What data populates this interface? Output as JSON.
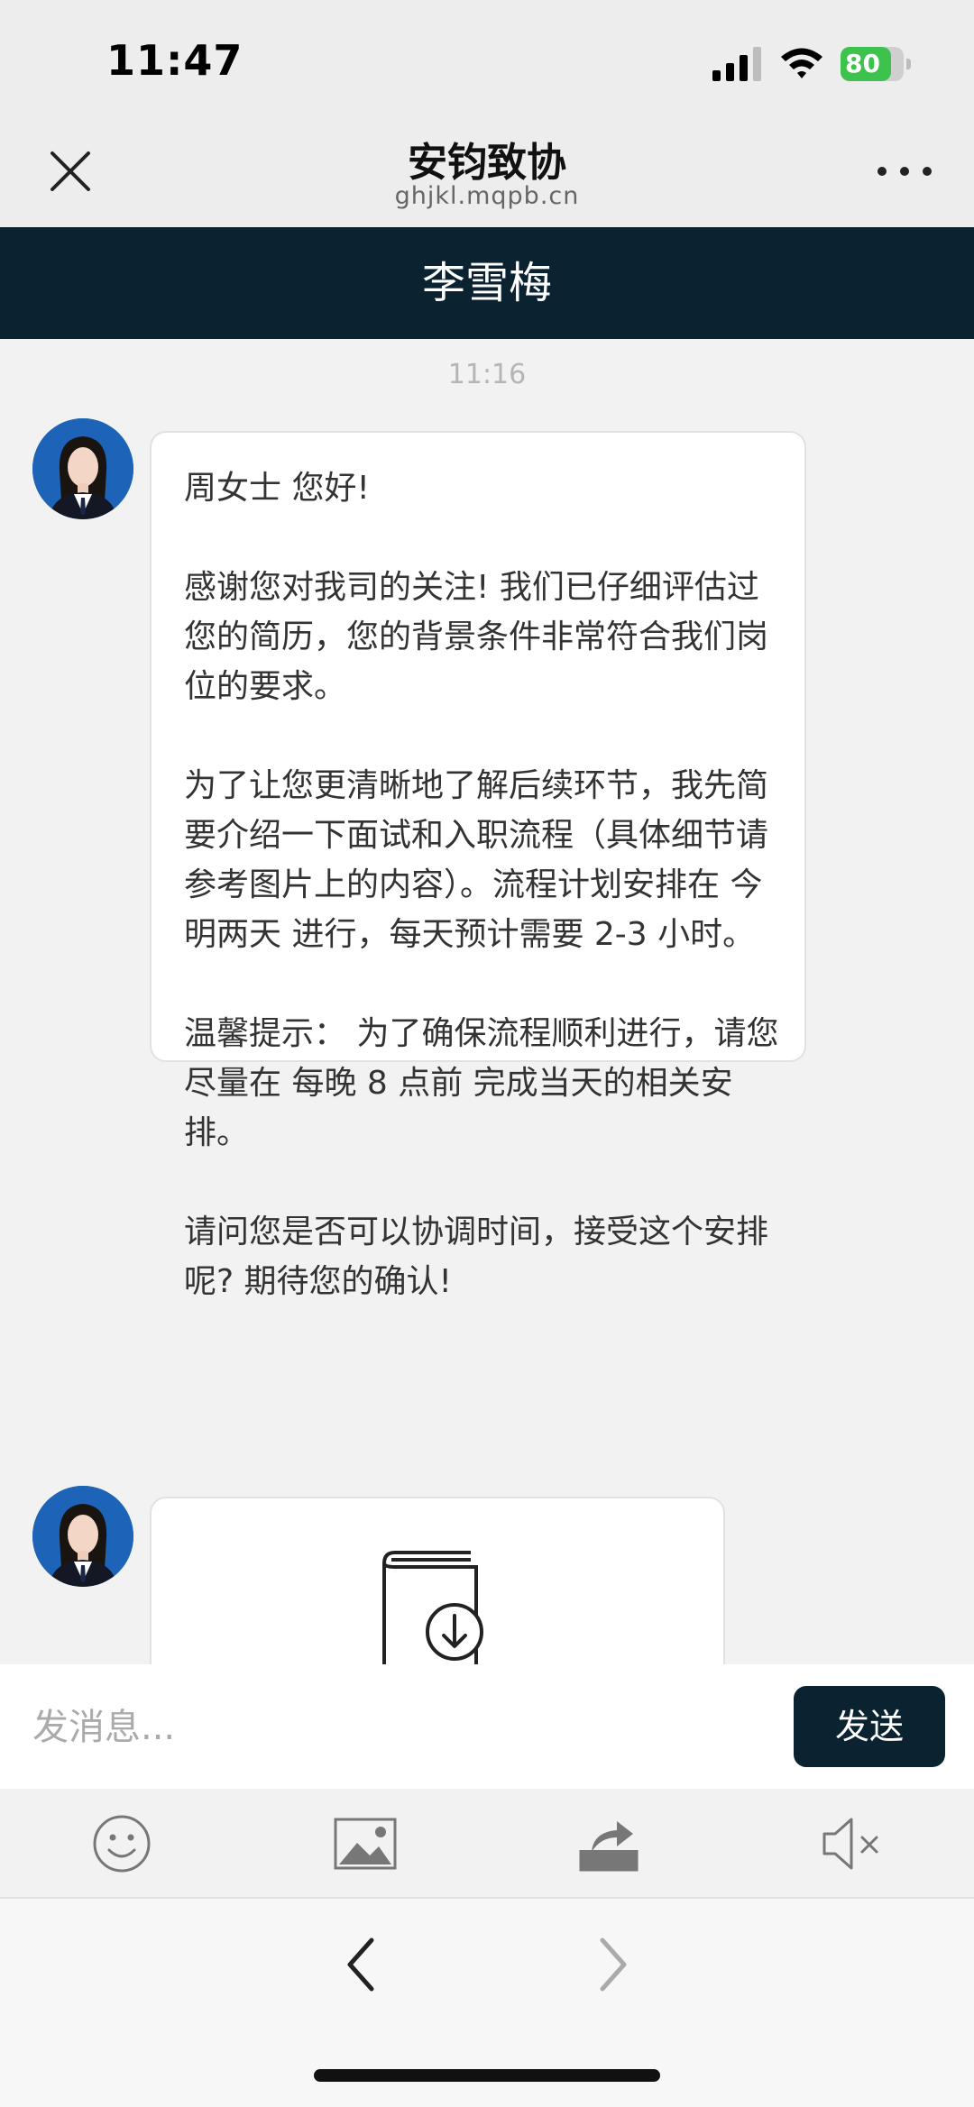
{
  "status_bar": {
    "time": "11:47",
    "battery": "80",
    "battery_percent": 80
  },
  "nav": {
    "title": "安钧致协",
    "url": "ghjkl.mqpb.cn"
  },
  "contact": {
    "name": "李雪梅"
  },
  "chat": {
    "timestamp": "11:16",
    "message": "周女士 您好!\n\n感谢您对我司的关注! 我们已仔细评估过您的简历，您的背景条件非常符合我们岗位的要求。\n\n为了让您更清晰地了解后续环节，我先简要介绍一下面试和入职流程（具体细节请参考图片上的内容）。流程计划安排在 今明两天 进行，每天预计需要 2-3 小时。\n\n温馨提示： 为了确保流程顺利进行，请您尽量在 每晚 8 点前 完成当天的相关安排。\n\n请问您是否可以协调时间，接受这个安排呢? 期待您的确认!"
  },
  "input": {
    "placeholder": "发消息...",
    "send_label": "发送"
  },
  "toolbar_icons": [
    "emoji-icon",
    "image-icon",
    "share-icon",
    "mute-icon"
  ],
  "colors": {
    "header_bg": "#0b2331",
    "battery": "#3dc34d",
    "bubble_bg": "#ffffff"
  }
}
